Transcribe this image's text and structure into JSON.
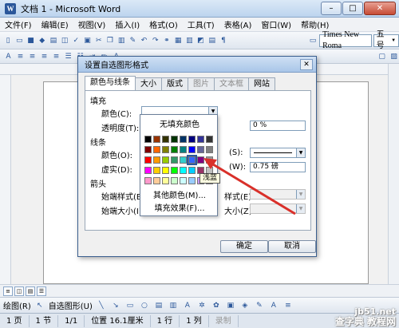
{
  "window": {
    "title": "文档 1 - Microsoft Word",
    "min": "–",
    "max": "□",
    "close": "✕"
  },
  "menubar": [
    "文件(F)",
    "编辑(E)",
    "视图(V)",
    "插入(I)",
    "格式(O)",
    "工具(T)",
    "表格(A)",
    "窗口(W)",
    "帮助(H)"
  ],
  "toolbar": {
    "font": "Times New Roma",
    "size": "五号"
  },
  "dialog": {
    "title": "设置自选图形格式",
    "close": "✕",
    "tabs": [
      "颜色与线条",
      "大小",
      "版式",
      "图片",
      "文本框",
      "网站"
    ],
    "fill_section": "填充",
    "fill_color_label": "颜色(C):",
    "transparency_label": "透明度(T):",
    "transparency_value": "0 %",
    "line_section": "线条",
    "line_color_label": "颜色(O):",
    "line_color_suffix": "(S):",
    "dash_label": "虚实(D):",
    "weight_suffix": "(W):",
    "weight_value": "0.75 磅",
    "arrows_section": "箭头",
    "begin_style_label": "始端样式(B):",
    "begin_size_label": "始端大小(I):",
    "end_style_suffix": "样式(E):",
    "end_size_suffix": "大小(Z):",
    "ok": "确定",
    "cancel": "取消"
  },
  "color_popup": {
    "no_fill": "无填充颜色",
    "more_colors": "其他颜色(M)...",
    "fill_effects": "填充效果(F)...",
    "tooltip": "浅蓝",
    "rows": [
      [
        "#000000",
        "#993300",
        "#333300",
        "#003300",
        "#003366",
        "#000080",
        "#333399",
        "#333333"
      ],
      [
        "#800000",
        "#FF6600",
        "#808000",
        "#008000",
        "#008080",
        "#0000FF",
        "#666699",
        "#808080"
      ],
      [
        "#FF0000",
        "#FF9900",
        "#99CC00",
        "#339966",
        "#33CCCC",
        "#3366FF",
        "#800080",
        "#969696"
      ],
      [
        "#FF00FF",
        "#FFCC00",
        "#FFFF00",
        "#00FF00",
        "#00FFFF",
        "#00CCFF",
        "#993366",
        "#C0C0C0"
      ],
      [
        "#FF99CC",
        "#FFCC99",
        "#FFFF99",
        "#CCFFCC",
        "#CCFFFF",
        "#99CCFF",
        "#CC99FF",
        "#FFFFFF"
      ]
    ]
  },
  "drawbar": {
    "draw": "绘图(R)",
    "autoshapes": "自选图形(U)"
  },
  "statusbar": [
    "1 页",
    "1 节",
    "1/1",
    "位置 16.1厘米",
    "1 行",
    "1 列",
    "录制"
  ],
  "watermark": "查字典 教程网\njiaocheng.chazidian.com",
  "watermark_top": "jb51.net"
}
